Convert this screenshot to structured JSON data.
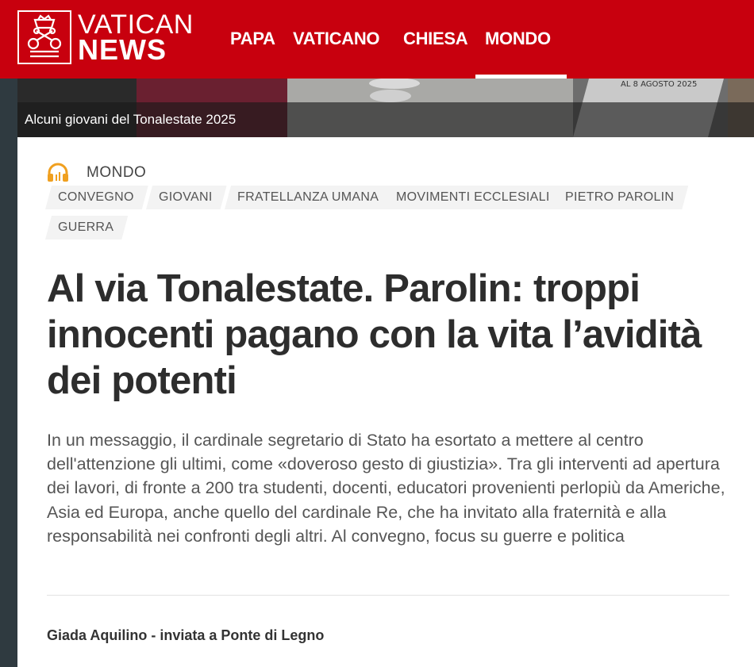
{
  "brand": {
    "line1": "VATICAN",
    "line2": "NEWS"
  },
  "nav": {
    "items": [
      {
        "label": "PAPA"
      },
      {
        "label": "VATICANO"
      },
      {
        "label": "CHIESA"
      },
      {
        "label": "MONDO",
        "active": true
      }
    ]
  },
  "hero": {
    "caption": "Alcuni giovani del Tonalestate 2025"
  },
  "article": {
    "section": "MONDO",
    "section_icon": "headphones-icon",
    "tags": [
      "CONVEGNO",
      "GIOVANI",
      "FRATELLANZA UMANA",
      "MOVIMENTI ECCLESIALI",
      "PIETRO PAROLIN",
      "GUERRA"
    ],
    "title": "Al via Tonalestate. Parolin: troppi innocenti pagano con la vita l’avidità dei potenti",
    "summary": "In un messaggio, il cardinale segretario di Stato ha esortato a mettere al centro dell'attenzione gli ultimi, come «doveroso gesto di giustizia». Tra gli interventi ad apertura dei lavori, di fronte a 200 tra studenti, docenti, educatori provenienti perlopiù da Americhe, Asia ed Europa, anche quello del cardinale Re, che ha invitato alla fraternità e alla responsabilità nei confronti degli altri. Al convegno, focus su guerre e politica",
    "author": "Giada Aquilino - inviata a Ponte di Legno"
  },
  "colors": {
    "brand_red": "#c8000e",
    "icon_orange": "#f0a020",
    "text_dark": "#2d2d2d",
    "tag_bg": "#f3f3f3"
  }
}
